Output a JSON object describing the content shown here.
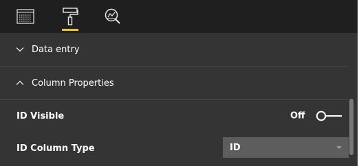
{
  "toolbar": {
    "icons": [
      {
        "name": "fields-icon"
      },
      {
        "name": "format-paint-roller-icon",
        "active": true
      },
      {
        "name": "analytics-icon"
      }
    ],
    "accent": "#f2c811"
  },
  "sections": [
    {
      "label": "Data entry",
      "expanded": false
    },
    {
      "label": "Column Properties",
      "expanded": true
    }
  ],
  "properties": {
    "id_visible": {
      "label": "ID Visible",
      "state": "Off"
    },
    "id_column_type": {
      "label": "ID Column Type",
      "value": "ID"
    }
  }
}
